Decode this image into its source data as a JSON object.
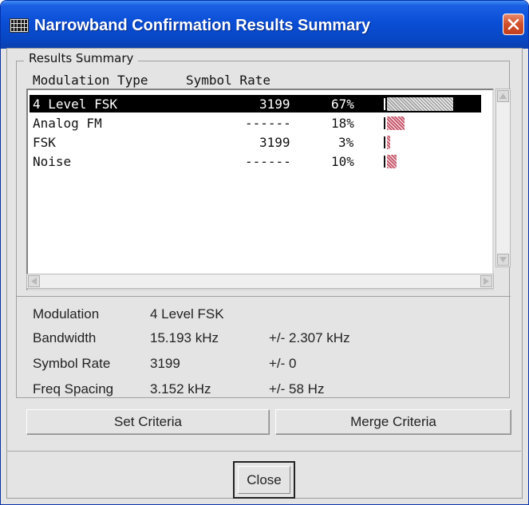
{
  "window": {
    "title": "Narrowband Confirmation Results Summary"
  },
  "results": {
    "group_title": "Results Summary",
    "headers": {
      "modulation_type": "Modulation Type",
      "symbol_rate": "Symbol Rate"
    },
    "rows": [
      {
        "type": "4 Level FSK",
        "rate": "3199",
        "percent": "67%",
        "fraction": 0.67,
        "selected": true
      },
      {
        "type": "Analog FM",
        "rate": "------",
        "percent": "18%",
        "fraction": 0.18,
        "selected": false
      },
      {
        "type": "FSK",
        "rate": "3199",
        "percent": "3%",
        "fraction": 0.03,
        "selected": false
      },
      {
        "type": "Noise",
        "rate": "------",
        "percent": "10%",
        "fraction": 0.1,
        "selected": false
      }
    ]
  },
  "details": {
    "modulation": {
      "label": "Modulation",
      "value": "4 Level FSK"
    },
    "bandwidth": {
      "label": "Bandwidth",
      "value": "15.193 kHz",
      "tolerance": "+/- 2.307 kHz"
    },
    "symbol_rate": {
      "label": "Symbol Rate",
      "value": "3199",
      "tolerance": "+/- 0"
    },
    "freq_spacing": {
      "label": "Freq Spacing",
      "value": "3.152 kHz",
      "tolerance": "+/- 58 Hz"
    }
  },
  "buttons": {
    "set_criteria": "Set Criteria",
    "merge_criteria": "Merge Criteria",
    "close": "Close"
  },
  "colors": {
    "bar_selected": "#a8a8a8",
    "bar_normal": "#c85a6e",
    "title_bar": "#0a4ed6",
    "close_x": "#d24e2a"
  }
}
